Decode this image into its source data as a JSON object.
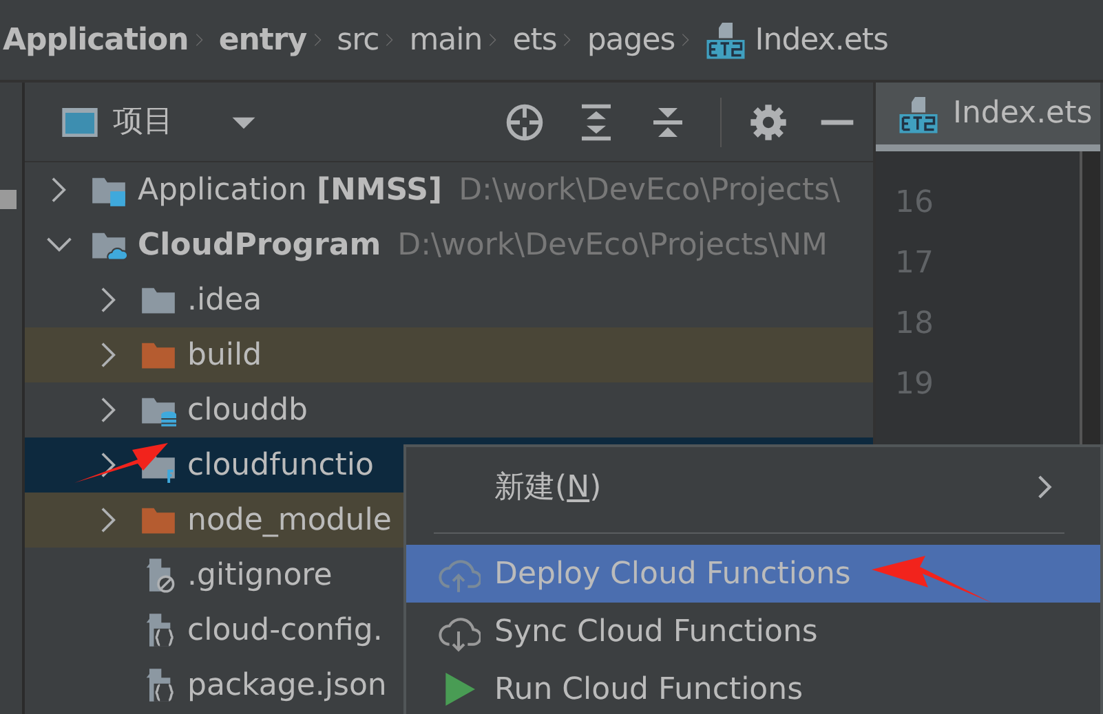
{
  "breadcrumb": [
    {
      "label": "Application",
      "bold": true,
      "kind": "folder"
    },
    {
      "label": "entry",
      "bold": true,
      "kind": "folder"
    },
    {
      "label": "src",
      "bold": false,
      "kind": "folder"
    },
    {
      "label": "main",
      "bold": false,
      "kind": "folder"
    },
    {
      "label": "ets",
      "bold": false,
      "kind": "folder"
    },
    {
      "label": "pages",
      "bold": false,
      "kind": "folder"
    },
    {
      "label": "Index.ets",
      "bold": false,
      "kind": "ets-file"
    }
  ],
  "project_panel": {
    "title": "项目",
    "tree": [
      {
        "kind": "module",
        "name": "Application",
        "tag": "[NMSS]",
        "path": "D:\\work\\DevEco\\Projects\\",
        "expanded": false,
        "selected": false,
        "excluded": false
      },
      {
        "kind": "cloud-module",
        "name": "CloudProgram",
        "path": "D:\\work\\DevEco\\Projects\\NM",
        "expanded": true,
        "selected": false,
        "excluded": false,
        "children": [
          {
            "kind": "folder",
            "name": ".idea",
            "expanded": false,
            "selected": false,
            "excluded": false
          },
          {
            "kind": "folder",
            "name": "build",
            "expanded": false,
            "selected": false,
            "excluded": true
          },
          {
            "kind": "db-folder",
            "name": "clouddb",
            "expanded": false,
            "selected": false,
            "excluded": false
          },
          {
            "kind": "function-folder",
            "name": "cloudfunctio",
            "expanded": false,
            "selected": true,
            "excluded": false
          },
          {
            "kind": "folder",
            "name": "node_module",
            "expanded": false,
            "selected": false,
            "excluded": true
          },
          {
            "kind": "ignore-file",
            "name": ".gitignore",
            "selected": false,
            "excluded": false
          },
          {
            "kind": "json-file",
            "name": "cloud-config.",
            "selected": false,
            "excluded": false
          },
          {
            "kind": "json-file",
            "name": "package.json",
            "selected": false,
            "excluded": false
          }
        ]
      }
    ]
  },
  "editor": {
    "tab": {
      "label": "Index.ets",
      "selected": true
    },
    "line_numbers": [
      "16",
      "17",
      "18",
      "19"
    ]
  },
  "context_menu": {
    "items": [
      {
        "kind": "submenu",
        "label": "新建(**N**)",
        "selected": false
      },
      {
        "kind": "separator"
      },
      {
        "kind": "upload",
        "label": "Deploy Cloud Functions",
        "selected": true
      },
      {
        "kind": "download",
        "label": "Sync Cloud Functions",
        "selected": false
      },
      {
        "kind": "run",
        "label": "Run Cloud Functions",
        "selected": false
      }
    ]
  }
}
